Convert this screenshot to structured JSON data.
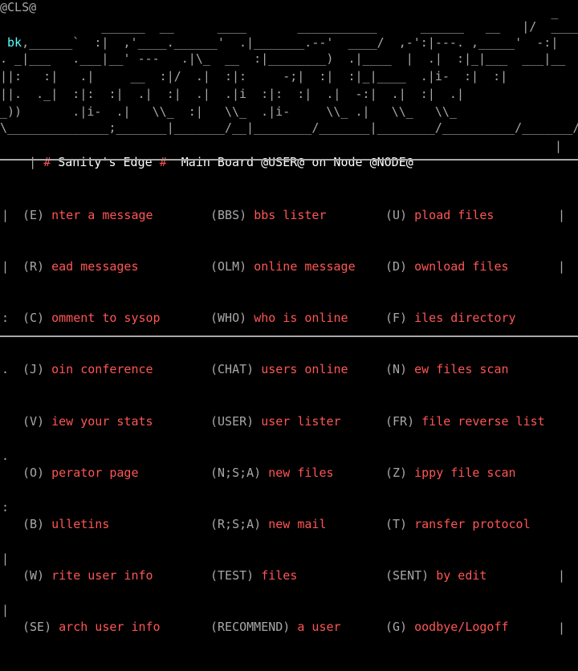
{
  "top_code": "@CLS@",
  "art_lines": [
    "                                                                            _      ",
    "              ______  __      ____       ___________      ______   __   |/  _____",
    " bk,______`  :|  ,'____.______'  .|_______.--'  ____/  ,-':|---. ,_____'  -:|",
    ". _|___   .___|__' ---   .|\\_  __  :|________)  .|____  |  .|  :|_|___  ___|__",
    "||:   :|   .|     __  :|/  .|  :|:     -;|  :|  :|_|____  .|i-  :|  :|",
    "||.  ._|  :|:  :|  .|  :|  .|  .|i  :|:  :|  .|  -:|  .|  :|  .|",
    "_))       .|i-  .|   \\\\_  :|   \\\\_  .|i-     \\\\_ .|   \\\\_   \\\\_",
    "\\______________;_______|_______/__|________/_______|________/__________/_______/"
  ],
  "header": {
    "bullet": "#",
    "bbs_name": "Sanity's Edge",
    "bullet2": "#",
    "board_label": "Main Board",
    "user_code": "@USER@",
    "on_node": "on Node",
    "node_code": "@NODE@"
  },
  "menu": {
    "col1": [
      {
        "key": "(E)",
        "label": "nter a message"
      },
      {
        "key": "(R)",
        "label": "ead messages"
      },
      {
        "key": "(C)",
        "label": "omment to sysop"
      },
      {
        "key": "(J)",
        "label": "oin conference"
      },
      {
        "key": "(V)",
        "label": "iew your stats"
      },
      {
        "key": "(O)",
        "label": "perator page"
      },
      {
        "key": "(B)",
        "label": "ulletins"
      },
      {
        "key": "(W)",
        "label": "rite user info"
      },
      {
        "key": "(SE)",
        "label": "arch user info"
      }
    ],
    "col2": [
      {
        "key": "(BBS)",
        "label": "bbs lister"
      },
      {
        "key": "(OLM)",
        "label": "online message"
      },
      {
        "key": "(WHO)",
        "label": "who is online"
      },
      {
        "key": "(CHAT)",
        "label": "users online"
      },
      {
        "key": "(USER)",
        "label": "user lister"
      },
      {
        "key": "(N;S;A)",
        "label": "new files"
      },
      {
        "key": "(R;S;A)",
        "label": "new mail"
      },
      {
        "key": "(TEST)",
        "label": "files"
      },
      {
        "key": "(RECOMMEND)",
        "label": "a user"
      }
    ],
    "col3": [
      {
        "key": "(U)",
        "label": "pload files"
      },
      {
        "key": "(D)",
        "label": "ownload files"
      },
      {
        "key": "(F)",
        "label": "iles directory"
      },
      {
        "key": "(N)",
        "label": "ew files scan"
      },
      {
        "key": "(FR)",
        "label": "file reverse list"
      },
      {
        "key": "(Z)",
        "label": "ippy file scan"
      },
      {
        "key": "(T)",
        "label": "ransfer protocol"
      },
      {
        "key": "(SENT)",
        "label": "by edit"
      },
      {
        "key": "(G)",
        "label": "oodbye/Logoff"
      }
    ]
  },
  "left_edge": [
    "|",
    "|",
    ":",
    ".",
    "",
    ".",
    ":",
    "|",
    "|"
  ],
  "right_edge": [
    "|",
    "|",
    "",
    "",
    "",
    "",
    "",
    "|",
    "|"
  ],
  "colors": {
    "background": "#000000",
    "text": "#a8a8a8",
    "highlight": "#ffffff",
    "label": "#ff5555",
    "accent": "#55ffff"
  }
}
